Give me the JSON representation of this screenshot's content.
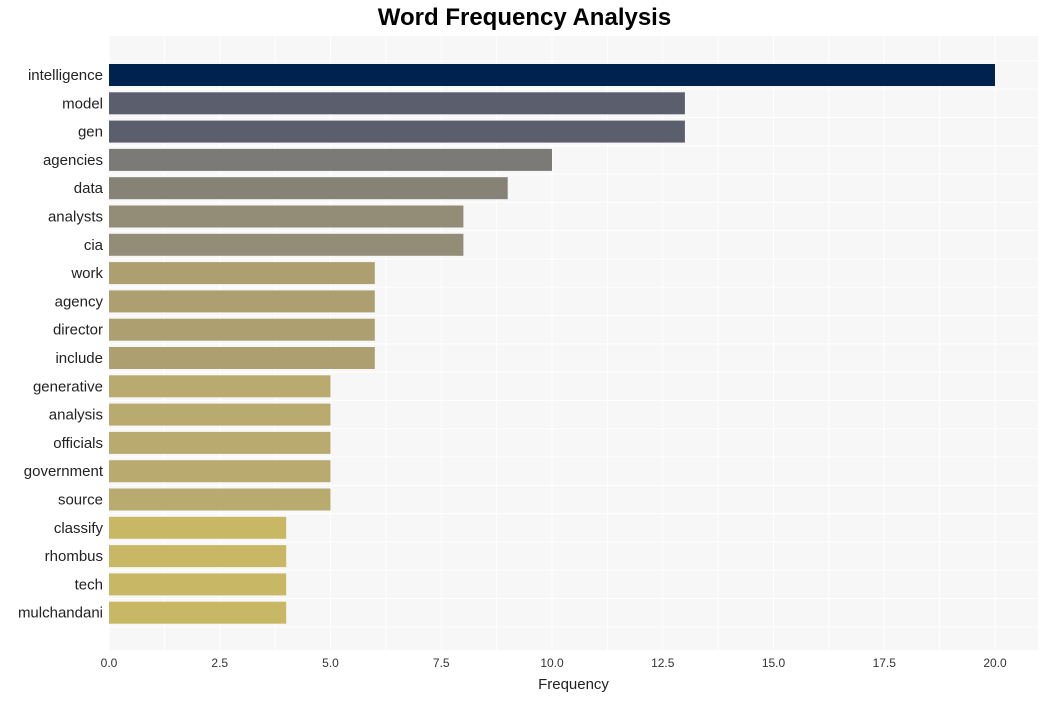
{
  "chart_data": {
    "type": "bar",
    "orientation": "horizontal",
    "title": "Word Frequency Analysis",
    "xlabel": "Frequency",
    "ylabel": "",
    "xlim": [
      0,
      21
    ],
    "grid": true,
    "xticks": [
      0.0,
      2.5,
      5.0,
      7.5,
      10.0,
      12.5,
      15.0,
      17.5,
      20.0
    ],
    "xtick_labels": [
      "0.0",
      "2.5",
      "5.0",
      "7.5",
      "10.0",
      "12.5",
      "15.0",
      "17.5",
      "20.0"
    ],
    "categories": [
      "intelligence",
      "model",
      "gen",
      "agencies",
      "data",
      "analysts",
      "cia",
      "work",
      "agency",
      "director",
      "include",
      "generative",
      "analysis",
      "officials",
      "government",
      "source",
      "classify",
      "rhombus",
      "tech",
      "mulchandani"
    ],
    "values": [
      20,
      13,
      13,
      10,
      9,
      8,
      8,
      6,
      6,
      6,
      6,
      5,
      5,
      5,
      5,
      5,
      4,
      4,
      4,
      4
    ],
    "colors": [
      "#00224e",
      "#5b5f6d",
      "#5b5f6d",
      "#7b7a76",
      "#868275",
      "#938c76",
      "#938c76",
      "#ad9f70",
      "#ad9f70",
      "#ad9f70",
      "#ad9f70",
      "#b9ab6f",
      "#b9ab6f",
      "#b9ab6f",
      "#b9ab6f",
      "#b9ab6f",
      "#c8b866",
      "#c8b866",
      "#c8b866",
      "#c8b866"
    ],
    "plot_background": "#f7f7f7",
    "grid_color": "#ffffff"
  }
}
